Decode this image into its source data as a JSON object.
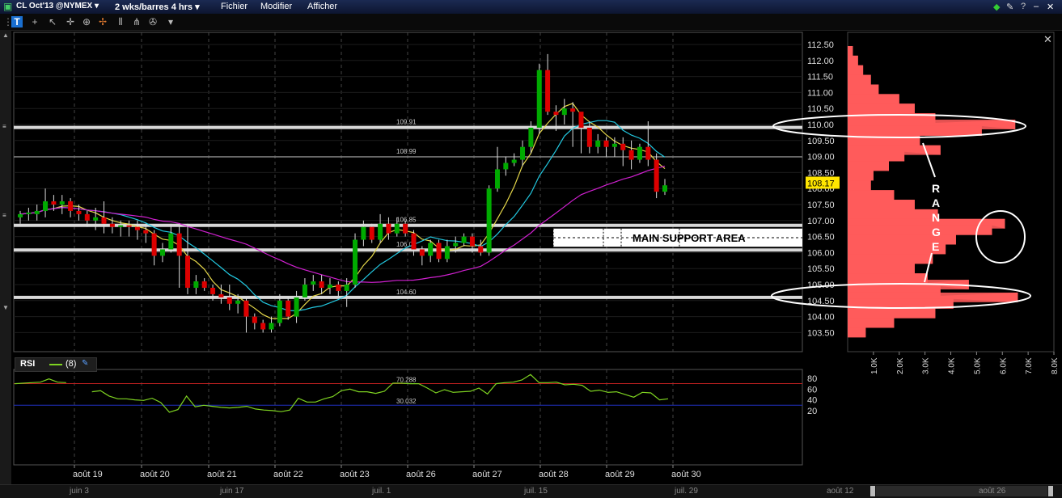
{
  "menubar": {
    "symbol": "CL Oct'13 @NYMEX",
    "timeframe": "2 wks/barres 4 hrs",
    "menus": [
      "Fichier",
      "Modifier",
      "Afficher"
    ]
  },
  "toolbar": {
    "icons": [
      "t-icon",
      "plus-icon",
      "cursor-icon",
      "crosshair-icon",
      "zoom-in-icon",
      "zoom-out-icon",
      "crosshair-icon",
      "bar-style-icon",
      "indicator-icon",
      "settings-icon",
      "dropdown-icon"
    ]
  },
  "colors": {
    "up": "#00aa00",
    "down": "#dd0000",
    "ma_fast": "#e6d84a",
    "ma_mid": "#22c8e0",
    "ma_slow": "#d020d0",
    "profile": "#ff5b5b",
    "rsi": "#7ed321"
  },
  "annotations": {
    "range": [
      "R",
      "A",
      "N",
      "G",
      "E"
    ],
    "support": "MAIN SUPPORT AREA"
  },
  "rsi": {
    "label": "RSI",
    "param": "(8)"
  },
  "bottom_scroll": {
    "labels": [
      "juin 3",
      "juin 17",
      "juil. 1",
      "juil. 15",
      "juil. 29",
      "août 12",
      "août 26"
    ]
  },
  "chart_data": [
    {
      "type": "candlestick",
      "title": "CL Oct'13 @NYMEX",
      "ylim": [
        103.2,
        112.8
      ],
      "y_ticks": [
        "112.50",
        "112.00",
        "111.50",
        "111.00",
        "110.50",
        "110.00",
        "109.50",
        "109.00",
        "108.50",
        "108.00",
        "107.50",
        "107.00",
        "106.50",
        "106.00",
        "105.50",
        "105.00",
        "104.50",
        "104.00",
        "103.50"
      ],
      "x_labels": [
        "août 19",
        "août 20",
        "août 21",
        "août 22",
        "août 23",
        "août 26",
        "août 27",
        "août 28",
        "août 29",
        "août 30"
      ],
      "last_price": "108.17",
      "horizontal_levels": [
        {
          "value": 109.91,
          "label": "109.91",
          "bold": true
        },
        {
          "value": 108.99,
          "label": "108.99",
          "bold": false
        },
        {
          "value": 106.85,
          "label": "106.85",
          "bold": true
        },
        {
          "value": 106.08,
          "label": "106.08",
          "bold": true
        },
        {
          "value": 104.6,
          "label": "104.60",
          "bold": true
        }
      ],
      "candles": [
        [
          107.1,
          107.2,
          107.3,
          106.9
        ],
        [
          107.2,
          107.25,
          107.4,
          107.0
        ],
        [
          107.2,
          107.3,
          107.5,
          107.0
        ],
        [
          107.3,
          107.6,
          108.0,
          107.1
        ],
        [
          107.6,
          107.5,
          107.8,
          107.3
        ],
        [
          107.5,
          107.6,
          107.8,
          107.2
        ],
        [
          107.6,
          107.3,
          107.7,
          107.1
        ],
        [
          107.3,
          107.2,
          107.5,
          107.0
        ],
        [
          107.2,
          107.0,
          107.3,
          106.8
        ],
        [
          107.0,
          107.1,
          107.4,
          106.7
        ],
        [
          107.1,
          106.9,
          107.6,
          106.6
        ],
        [
          106.9,
          106.8,
          107.1,
          106.6
        ],
        [
          106.8,
          106.85,
          107.0,
          106.5
        ],
        [
          106.85,
          106.8,
          107.0,
          106.5
        ],
        [
          106.8,
          106.7,
          107.0,
          106.4
        ],
        [
          106.7,
          106.6,
          106.9,
          106.3
        ],
        [
          106.6,
          105.9,
          106.7,
          105.6
        ],
        [
          105.9,
          106.1,
          106.3,
          105.7
        ],
        [
          106.1,
          106.6,
          106.9,
          106.0
        ],
        [
          106.6,
          105.9,
          106.9,
          104.9
        ],
        [
          105.9,
          104.9,
          106.9,
          104.7
        ],
        [
          104.9,
          105.1,
          105.3,
          104.7
        ],
        [
          105.1,
          104.9,
          105.2,
          104.8
        ],
        [
          104.9,
          104.7,
          105.0,
          104.5
        ],
        [
          104.7,
          104.6,
          105.0,
          104.4
        ],
        [
          104.6,
          104.4,
          105.0,
          104.2
        ],
        [
          104.4,
          104.5,
          104.7,
          104.1
        ],
        [
          104.5,
          104.0,
          104.6,
          103.5
        ],
        [
          104.0,
          103.8,
          104.1,
          103.6
        ],
        [
          103.8,
          103.6,
          103.9,
          103.5
        ],
        [
          103.6,
          103.8,
          104.0,
          103.5
        ],
        [
          103.8,
          104.5,
          104.7,
          103.7
        ],
        [
          104.5,
          104.0,
          104.6,
          103.9
        ],
        [
          104.0,
          104.6,
          104.8,
          103.8
        ],
        [
          104.6,
          105.0,
          105.2,
          104.5
        ],
        [
          105.0,
          105.1,
          105.3,
          104.8
        ],
        [
          105.1,
          104.9,
          105.3,
          104.7
        ],
        [
          104.9,
          105.0,
          105.2,
          104.7
        ],
        [
          105.0,
          104.8,
          105.1,
          104.6
        ],
        [
          104.8,
          105.0,
          105.2,
          104.3
        ],
        [
          105.0,
          106.4,
          106.6,
          104.9
        ],
        [
          106.4,
          106.8,
          107.0,
          106.2
        ],
        [
          106.8,
          106.4,
          106.9,
          106.3
        ],
        [
          106.4,
          106.9,
          107.2,
          106.3
        ],
        [
          106.9,
          106.6,
          107.1,
          106.4
        ],
        [
          106.6,
          106.9,
          107.1,
          106.5
        ],
        [
          106.9,
          106.6,
          107.0,
          106.5
        ],
        [
          106.6,
          106.1,
          106.7,
          105.9
        ],
        [
          106.1,
          105.9,
          106.2,
          105.6
        ],
        [
          105.9,
          106.3,
          106.4,
          105.7
        ],
        [
          106.3,
          105.8,
          106.4,
          105.7
        ],
        [
          105.8,
          106.2,
          106.4,
          105.7
        ],
        [
          106.2,
          106.3,
          106.5,
          106.0
        ],
        [
          106.3,
          106.5,
          106.6,
          106.2
        ],
        [
          106.5,
          106.2,
          106.6,
          106.0
        ],
        [
          106.2,
          106.0,
          106.4,
          105.9
        ],
        [
          106.0,
          108.0,
          108.1,
          105.9
        ],
        [
          108.0,
          108.6,
          109.3,
          107.9
        ],
        [
          108.6,
          108.8,
          109.0,
          108.4
        ],
        [
          108.8,
          108.9,
          109.1,
          108.7
        ],
        [
          108.9,
          109.3,
          109.5,
          108.7
        ],
        [
          109.3,
          109.9,
          110.1,
          109.1
        ],
        [
          109.9,
          111.7,
          111.9,
          109.7
        ],
        [
          111.7,
          110.4,
          112.2,
          110.3
        ],
        [
          110.4,
          110.3,
          110.6,
          109.8
        ],
        [
          110.3,
          110.5,
          110.8,
          110.0
        ],
        [
          110.5,
          110.4,
          110.7,
          109.3
        ],
        [
          110.4,
          109.9,
          110.3,
          109.1
        ],
        [
          109.9,
          109.3,
          110.1,
          109.1
        ],
        [
          109.3,
          109.5,
          109.7,
          109.1
        ],
        [
          109.5,
          109.3,
          109.6,
          109.0
        ],
        [
          109.3,
          109.4,
          109.6,
          109.0
        ],
        [
          109.4,
          109.2,
          109.6,
          108.7
        ],
        [
          109.2,
          108.9,
          109.5,
          108.6
        ],
        [
          108.9,
          109.3,
          109.4,
          108.8
        ],
        [
          109.3,
          108.9,
          110.1,
          108.7
        ],
        [
          108.9,
          107.9,
          109.1,
          107.7
        ],
        [
          107.9,
          108.1,
          108.3,
          107.8
        ]
      ]
    },
    {
      "type": "line",
      "title": "RSI",
      "ylim": [
        10,
        95
      ],
      "y_ticks": [
        "80",
        "60",
        "40",
        "20"
      ],
      "levels": [
        {
          "value": 70.288,
          "label": "70.288"
        },
        {
          "value": 30.032,
          "label": "30.032"
        }
      ],
      "values": [
        70,
        71,
        72,
        73,
        79,
        73,
        72,
        null,
        null,
        55,
        57,
        47,
        42,
        42,
        40,
        39,
        43,
        35,
        17,
        22,
        47,
        27,
        30,
        28,
        26,
        25,
        26,
        28,
        23,
        21,
        20,
        18,
        21,
        43,
        36,
        36,
        42,
        46,
        57,
        60,
        55,
        55,
        52,
        56,
        71,
        71,
        70,
        70,
        62,
        53,
        59,
        54,
        55,
        56,
        62,
        51,
        70,
        72,
        73,
        77,
        87,
        72,
        72,
        73,
        68,
        69,
        67,
        56,
        58,
        54,
        55,
        50,
        45,
        54,
        53,
        40,
        42
      ],
      "x_labels": [
        "août 19",
        "août 20",
        "août 21",
        "août 22",
        "août 23",
        "août 26",
        "août 27",
        "août 28",
        "août 29",
        "août 30"
      ]
    },
    {
      "type": "bar",
      "title": "Volume profile",
      "orientation": "horizontal",
      "x_ticks": [
        "1.0K",
        "2.0K",
        "3.0K",
        "4.0K",
        "5.0K",
        "6.0K",
        "7.0K",
        "8.0K"
      ],
      "xlim": [
        0,
        8000
      ],
      "price_levels": [
        112.3,
        112.0,
        111.7,
        111.4,
        111.1,
        110.8,
        110.5,
        110.2,
        110.0,
        109.8,
        109.5,
        109.2,
        109.0,
        108.7,
        108.4,
        108.1,
        107.8,
        107.5,
        107.2,
        106.9,
        106.7,
        106.4,
        106.1,
        105.8,
        105.5,
        105.2,
        105.0,
        104.8,
        104.6,
        104.4,
        104.1,
        103.8,
        103.5
      ],
      "values": [
        200,
        400,
        600,
        900,
        1200,
        2000,
        2600,
        3400,
        6500,
        5200,
        2800,
        3600,
        2200,
        1600,
        1000,
        900,
        1800,
        2600,
        3500,
        6100,
        5600,
        4200,
        3800,
        3300,
        2600,
        3100,
        4700,
        3600,
        6600,
        4100,
        3400,
        1800,
        700
      ]
    }
  ]
}
